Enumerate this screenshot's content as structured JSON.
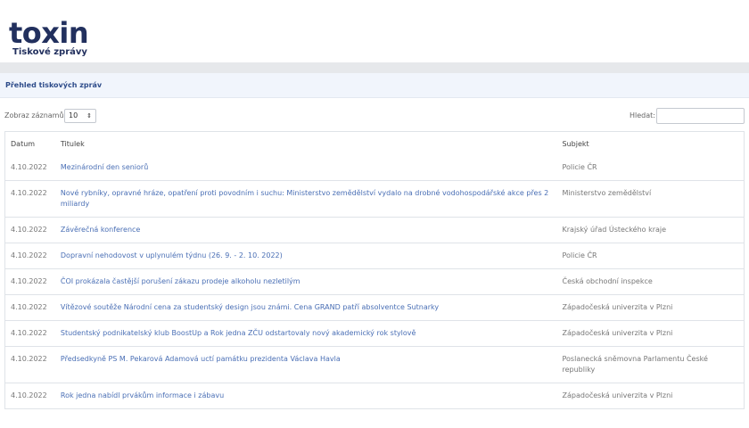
{
  "brand": {
    "logo": "toxin",
    "subtitle": "Tiskové zprávy"
  },
  "section": {
    "title": "Přehled tiskových zpráv"
  },
  "controls": {
    "length_label": "Zobraz záznamů",
    "length_value": "10",
    "search_label": "Hledat:",
    "search_value": ""
  },
  "table": {
    "headers": {
      "date": "Datum",
      "title": "Titulek",
      "subject": "Subjekt"
    },
    "rows": [
      {
        "date": "4.10.2022",
        "title": "Mezinárodní den seniorů",
        "subject": "Policie ČR"
      },
      {
        "date": "4.10.2022",
        "title": "Nové rybníky, opravné hráze, opatření proti povodním i suchu: Ministerstvo zemědělství vydalo na drobné vodohospodářské akce přes 2 miliardy",
        "subject": "Ministerstvo zemědělství"
      },
      {
        "date": "4.10.2022",
        "title": "Závěrečná konference",
        "subject": "Krajský úřad Ústeckého kraje"
      },
      {
        "date": "4.10.2022",
        "title": "Dopravní nehodovost v uplynulém týdnu (26. 9. - 2. 10. 2022)",
        "subject": "Policie ČR"
      },
      {
        "date": "4.10.2022",
        "title": "ČOI prokázala častější porušení zákazu prodeje alkoholu nezletilým",
        "subject": "Česká obchodní inspekce"
      },
      {
        "date": "4.10.2022",
        "title": "Vítězové soutěže Národní cena za studentský design jsou známi. Cena GRAND patří absolventce Sutnarky",
        "subject": "Západočeská univerzita v Plzni"
      },
      {
        "date": "4.10.2022",
        "title": "Studentský podnikatelský klub BoostUp a Rok jedna ZČU odstartovaly nový akademický rok stylově",
        "subject": "Západočeská univerzita v Plzni"
      },
      {
        "date": "4.10.2022",
        "title": "Předsedkyně PS M. Pekarová Adamová uctí památku prezidenta Václava Havla",
        "subject": "Poslanecká sněmovna Parlamentu České republiky"
      },
      {
        "date": "4.10.2022",
        "title": "Rok jedna nabídl prvákům informace i zábavu",
        "subject": "Západočeská univerzita v Plzni"
      }
    ]
  }
}
